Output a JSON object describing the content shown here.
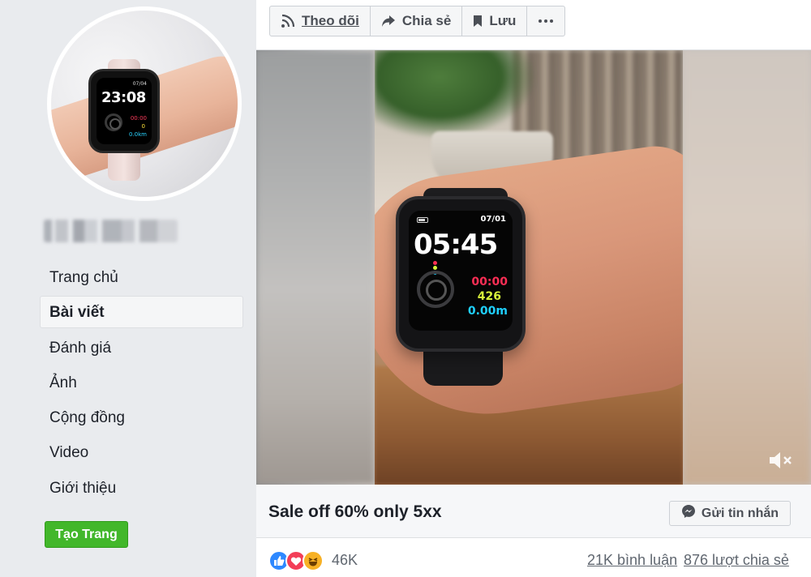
{
  "header": {
    "actions": [
      {
        "label": "Theo dõi",
        "icon": "rss-icon"
      },
      {
        "label": "Chia sẻ",
        "icon": "share-arrow-icon"
      },
      {
        "label": "Lưu",
        "icon": "bookmark-icon"
      },
      {
        "label": "",
        "icon": "more-dots-icon"
      }
    ]
  },
  "sidebar": {
    "nav_items": [
      {
        "label": "Trang chủ",
        "active": false
      },
      {
        "label": "Bài viết",
        "active": true
      },
      {
        "label": "Đánh giá",
        "active": false
      },
      {
        "label": "Ảnh",
        "active": false
      },
      {
        "label": "Cộng đồng",
        "active": false
      },
      {
        "label": "Video",
        "active": false
      },
      {
        "label": "Giới thiệu",
        "active": false
      }
    ],
    "create_page_label": "Tạo Trang"
  },
  "profile_watch": {
    "date": "07/04",
    "time": "23:08",
    "stat_red": "00:00",
    "stat_yellow": "0",
    "stat_cyan": "0.0km"
  },
  "video": {
    "watch": {
      "date": "07/01",
      "time": "05:45",
      "stat_red": "00:00",
      "stat_green": "426",
      "stat_cyan": "0.00m"
    },
    "mute_icon": "speaker-muted-icon"
  },
  "post": {
    "caption": "Sale off 60% only 5xx",
    "send_message_label": "Gửi tin nhắn",
    "reaction_count": "46K",
    "comments": "21K bình luận",
    "shares": "876 lượt chia sẻ"
  },
  "colors": {
    "create_button": "#42b72a",
    "like": "#2d88ff",
    "love": "#f33e58",
    "haha": "#f7b125"
  }
}
